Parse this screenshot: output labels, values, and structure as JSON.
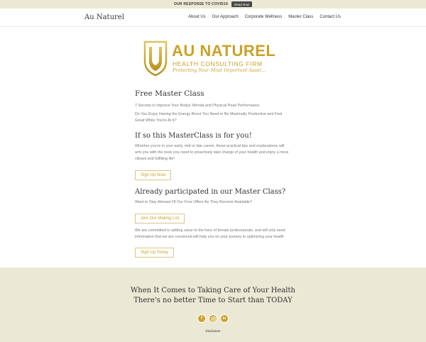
{
  "topbar": {
    "text": "OUR RESPONSE TO COVID19",
    "button": "Read Now"
  },
  "header": {
    "brand": "Au Naturel",
    "nav": [
      "About Us",
      "Our Approach",
      "Corporate Wellness",
      "Master Class",
      "Contact Us"
    ]
  },
  "logo": {
    "title": "AU NATUREL",
    "subtitle": "HEALTH CONSULTING FIRM",
    "tagline": "Protecting Your Most Important Asset...",
    "colors": {
      "gold": "#c9a227"
    }
  },
  "main": {
    "title": "Free Master Class",
    "intro1": "7 Secrets to Improve Your Bodys' Mental and Physical Peak Performance.",
    "intro2": "Do You Enjoy Having the Energy Boost You Need to Be Maximally Productive and Feel Great While You're At It?",
    "section1_heading": "If so this MasterClass is for you!",
    "section1_text": "Whether you're in your early, mid or late career, these practical tips and explanations will arm you with the tools you need to proactively take charge of your health and enjoy a more vibrant and fulfilling life!",
    "signup_now": "Sign Up Now",
    "section2_heading": "Already participated in our Master Class?",
    "section2_text": "Want to Stay Abreast Of Our Free Offers As They Become Available?",
    "mailing_list": "Join Our Mailing List",
    "section3_text": "We are committed to adding value to the lives of female professionals, and will only send information that we are convinced will help you on your journey to optimizing your health",
    "signup_today": "Sign Up Today"
  },
  "footer": {
    "line1": "When It Comes to Taking Care of Your Health",
    "line2": "There's no better Time to Start than TODAY",
    "social": [
      "facebook-icon",
      "instagram-icon",
      "linkedin-icon"
    ],
    "disclaimer": "Disclaimer"
  }
}
